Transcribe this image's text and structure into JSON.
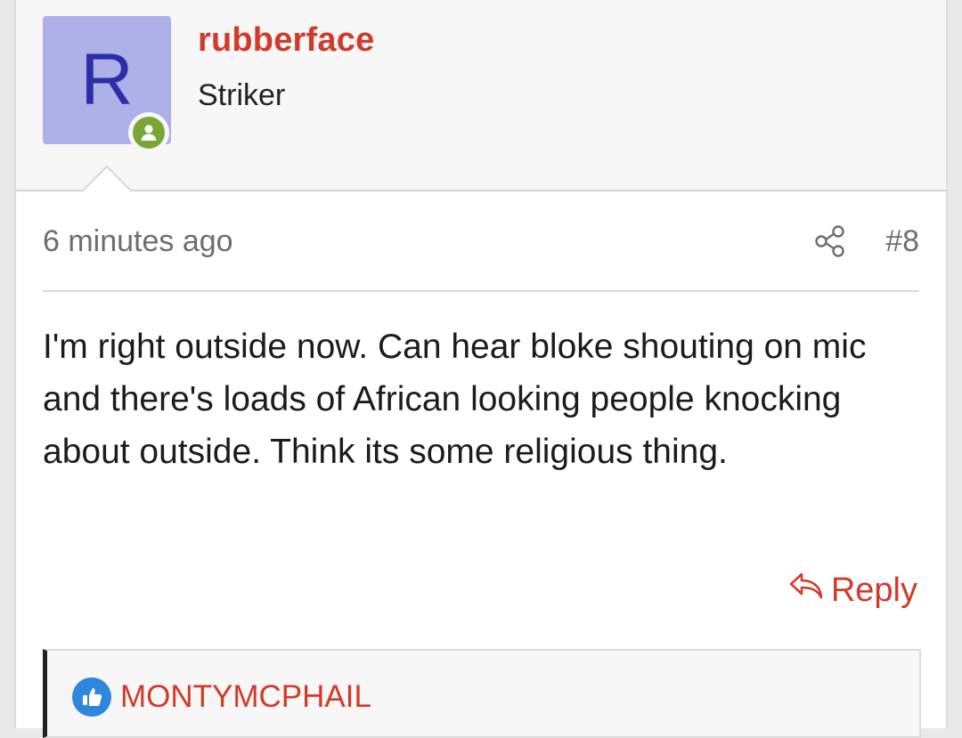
{
  "post": {
    "author": {
      "avatar_letter": "R",
      "username": "rubberface",
      "title": "Striker"
    },
    "time_ago": "6 minutes ago",
    "post_number": "#8",
    "message": "I'm right outside now. Can hear bloke shouting on mic and there's loads of African looking people knocking about outside. Think its some religious thing.",
    "reply_label": "Reply",
    "reactions": {
      "users": [
        "MONTYMCPHAIL"
      ]
    }
  },
  "colors": {
    "accent": "#d13b2a",
    "avatar_bg": "#aeb0e8",
    "avatar_letter": "#2c2ea8",
    "online": "#7aa637",
    "like": "#2f86dd"
  },
  "icons": [
    "online-status-icon",
    "share-icon",
    "reply-icon",
    "like-icon"
  ]
}
